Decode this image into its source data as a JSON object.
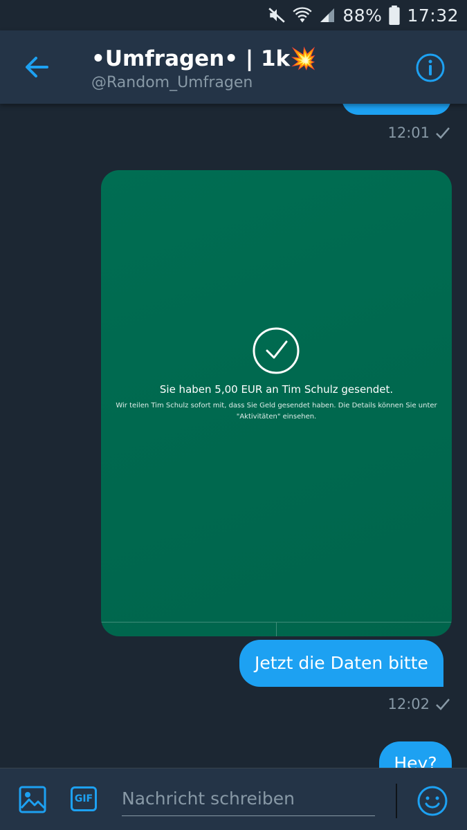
{
  "status_bar": {
    "battery": "88%",
    "time": "17:32",
    "icons": [
      "mute-icon",
      "wifi-icon",
      "signal-icon",
      "battery-icon"
    ]
  },
  "header": {
    "title": "•Umfragen• | 1k",
    "title_emoji": "💥",
    "handle": "@Random_Umfragen"
  },
  "messages": {
    "time_1": "12:01",
    "payment_card": {
      "title": "Sie haben 5,00 EUR an Tim Schulz gesendet.",
      "subtitle": "Wir teilen Tim Schulz sofort mit, dass Sie Geld gesendet haben. Die Details können Sie unter \"Aktivitäten\" einsehen."
    },
    "text_1": "Jetzt die Daten bitte",
    "time_2": "12:02",
    "text_2": "Hey?"
  },
  "composer": {
    "placeholder": "Nachricht schreiben",
    "gif_label": "GIF"
  },
  "colors": {
    "background": "#1c2733",
    "header": "#243447",
    "accent": "#1da1f2",
    "card": "#006b51",
    "muted": "#8899a6"
  }
}
